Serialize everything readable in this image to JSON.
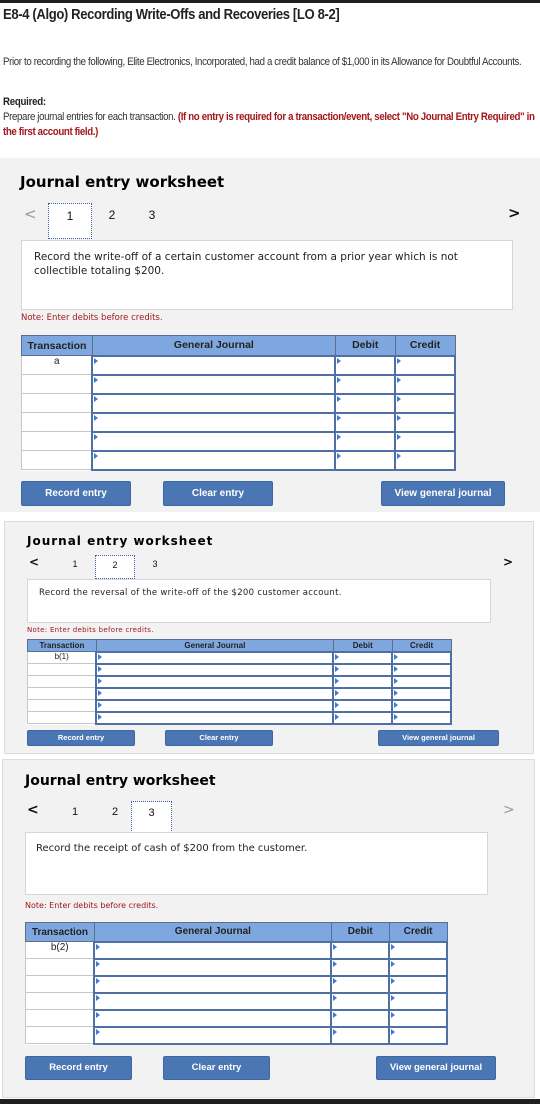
{
  "header": {
    "title": "E8-4 (Algo) Recording Write-Offs and Recoveries [LO 8-2]",
    "intro": "Prior to recording the following, Elite Electronics, Incorporated, had a credit balance of $1,000 in its Allowance for Doubtful Accounts.",
    "required_label": "Required:",
    "instructions_plain": "Prepare journal entries for each transaction. ",
    "instructions_red": "(If no entry is required for a transaction/event, select \"No Journal Entry Required\" in the first account field.)"
  },
  "worksheets": [
    {
      "title": "Journal entry worksheet",
      "prev_arrow": "<",
      "next_arrow": ">",
      "tabs": [
        "1",
        "2",
        "3"
      ],
      "active_tab": "1",
      "prompt": "Record the write-off of a certain customer account from a prior year which is not collectible totaling $200.",
      "note": "Note: Enter debits before credits.",
      "columns": [
        "Transaction",
        "General Journal",
        "Debit",
        "Credit"
      ],
      "rows": [
        {
          "transaction": "a",
          "account": "",
          "debit": "",
          "credit": ""
        },
        {
          "transaction": "",
          "account": "",
          "debit": "",
          "credit": ""
        },
        {
          "transaction": "",
          "account": "",
          "debit": "",
          "credit": ""
        },
        {
          "transaction": "",
          "account": "",
          "debit": "",
          "credit": ""
        },
        {
          "transaction": "",
          "account": "",
          "debit": "",
          "credit": ""
        },
        {
          "transaction": "",
          "account": "",
          "debit": "",
          "credit": ""
        }
      ],
      "buttons": {
        "record": "Record entry",
        "clear": "Clear entry",
        "view": "View general journal"
      }
    },
    {
      "title": "Journal entry worksheet",
      "prev_arrow": "<",
      "next_arrow": ">",
      "tabs": [
        "1",
        "2",
        "3"
      ],
      "active_tab": "2",
      "prompt": "Record the reversal of the write-off of the $200 customer account.",
      "note": "Note: Enter debits before credits.",
      "columns": [
        "Transaction",
        "General Journal",
        "Debit",
        "Credit"
      ],
      "rows": [
        {
          "transaction": "b(1)",
          "account": "",
          "debit": "",
          "credit": ""
        },
        {
          "transaction": "",
          "account": "",
          "debit": "",
          "credit": ""
        },
        {
          "transaction": "",
          "account": "",
          "debit": "",
          "credit": ""
        },
        {
          "transaction": "",
          "account": "",
          "debit": "",
          "credit": ""
        },
        {
          "transaction": "",
          "account": "",
          "debit": "",
          "credit": ""
        },
        {
          "transaction": "",
          "account": "",
          "debit": "",
          "credit": ""
        }
      ],
      "buttons": {
        "record": "Record entry",
        "clear": "Clear entry",
        "view": "View general journal"
      }
    },
    {
      "title": "Journal entry worksheet",
      "prev_arrow": "<",
      "next_arrow": ">",
      "tabs": [
        "1",
        "2",
        "3"
      ],
      "active_tab": "3",
      "prompt": "Record the receipt of cash of $200 from the customer.",
      "note": "Note: Enter debits before credits.",
      "columns": [
        "Transaction",
        "General Journal",
        "Debit",
        "Credit"
      ],
      "rows": [
        {
          "transaction": "b(2)",
          "account": "",
          "debit": "",
          "credit": ""
        },
        {
          "transaction": "",
          "account": "",
          "debit": "",
          "credit": ""
        },
        {
          "transaction": "",
          "account": "",
          "debit": "",
          "credit": ""
        },
        {
          "transaction": "",
          "account": "",
          "debit": "",
          "credit": ""
        },
        {
          "transaction": "",
          "account": "",
          "debit": "",
          "credit": ""
        },
        {
          "transaction": "",
          "account": "",
          "debit": "",
          "credit": ""
        }
      ],
      "buttons": {
        "record": "Record entry",
        "clear": "Clear entry",
        "view": "View general journal"
      }
    }
  ],
  "colors": {
    "accent_button": "#4a76b3",
    "table_header": "#7fa7df",
    "note_red": "#a4161a",
    "panel_bg": "#f2f2f2"
  }
}
